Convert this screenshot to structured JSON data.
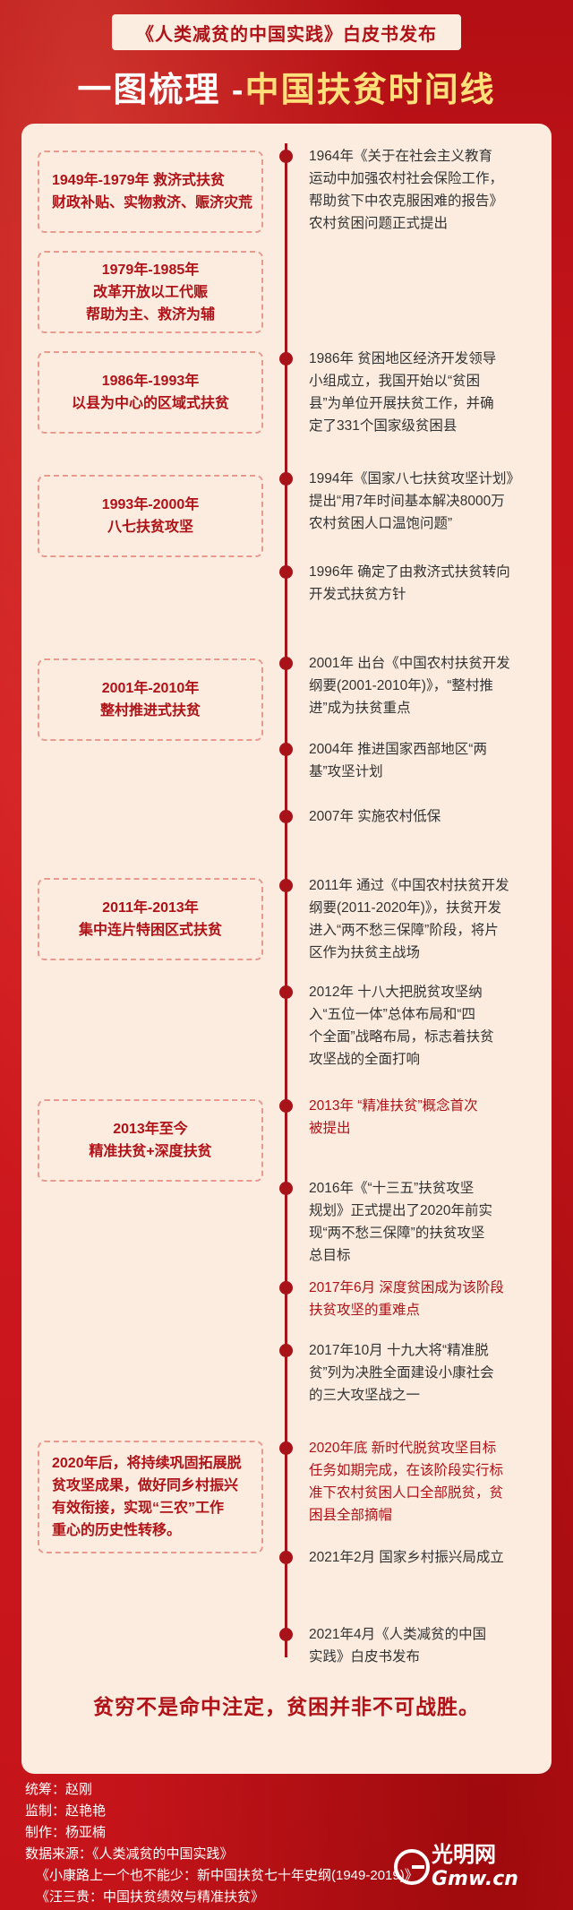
{
  "header": {
    "banner": "《人类减贫的中国实践》白皮书发布",
    "title_part1": "一图梳理 - ",
    "title_part2": "中国扶贫时间线"
  },
  "eras": [
    {
      "lines": [
        "1949年-1979年 救济式扶贫",
        "财政补贴、实物救济、赈济灾荒"
      ]
    },
    {
      "lines": [
        "1979年-1985年",
        "改革开放以工代赈",
        "帮助为主、救济为辅"
      ]
    },
    {
      "lines": [
        "1986年-1993年",
        "以县为中心的区域式扶贫"
      ]
    },
    {
      "lines": [
        "1993年-2000年",
        "八七扶贫攻坚"
      ]
    },
    {
      "lines": [
        "2001年-2010年",
        "整村推进式扶贫"
      ]
    },
    {
      "lines": [
        "2011年-2013年",
        "集中连片特困区式扶贫"
      ]
    },
    {
      "lines": [
        "2013年至今",
        "精准扶贫+深度扶贫"
      ]
    },
    {
      "lines": [
        "2020年后，将持续巩固拓展脱",
        "贫攻坚成果，做好同乡村振兴",
        "有效衔接，实现“三农”工作",
        "重心的历史性转移。"
      ]
    }
  ],
  "events": [
    {
      "lines": [
        "1964年《关于在社会主义教育",
        "运动中加强农村社会保险工作，",
        "帮助贫下中农克服困难的报告》",
        "农村贫困问题正式提出"
      ]
    },
    {
      "lines": [
        "1986年 贫困地区经济开发领导",
        "小组成立，我国开始以“贫困",
        "县”为单位开展扶贫工作，并确",
        "定了331个国家级贫困县"
      ]
    },
    {
      "lines": [
        "1994年《国家八七扶贫攻坚计划》",
        "提出“用7年时间基本解决8000万",
        "农村贫困人口温饱问题”"
      ]
    },
    {
      "lines": [
        "1996年 确定了由救济式扶贫转向",
        "开发式扶贫方针"
      ]
    },
    {
      "lines": [
        "2001年 出台《中国农村扶贫开发",
        "纲要(2001-2010年)》，“整村推",
        "进”成为扶贫重点"
      ]
    },
    {
      "lines": [
        "2004年 推进国家西部地区“两",
        "基”攻坚计划"
      ]
    },
    {
      "lines": [
        "2007年 实施农村低保"
      ]
    },
    {
      "lines": [
        "2011年 通过《中国农村扶贫开发",
        "纲要(2011-2020年)》，扶贫开发",
        "进入“两不愁三保障”阶段，将片",
        "区作为扶贫主战场"
      ]
    },
    {
      "lines": [
        "2012年 十八大把脱贫攻坚纳",
        "入“五位一体”总体布局和“四",
        "个全面”战略布局，标志着扶贫",
        "攻坚战的全面打响"
      ]
    },
    {
      "lines": [
        "2013年 “精准扶贫”概念首次",
        "被提出"
      ]
    },
    {
      "lines": [
        "2016年《“十三五”扶贫攻坚",
        "规划》正式提出了2020年前实",
        "现“两不愁三保障”的扶贫攻坚",
        "总目标"
      ]
    },
    {
      "lines": [
        "2017年6月 深度贫困成为该阶段",
        "扶贫攻坚的重难点"
      ]
    },
    {
      "lines": [
        "2017年10月 十九大将“精准脱",
        "贫”列为决胜全面建设小康社会",
        "的三大攻坚战之一"
      ]
    },
    {
      "lines": [
        "2020年底 新时代脱贫攻坚目标",
        "任务如期完成，在该阶段实行标",
        "准下农村贫困人口全部脱贫，贫",
        "困县全部摘帽"
      ]
    },
    {
      "lines": [
        "2021年2月 国家乡村振兴局成立"
      ]
    },
    {
      "lines": [
        "2021年4月《人类减贫的中国",
        "实践》白皮书发布"
      ]
    }
  ],
  "slogan": "贫穷不是命中注定，贫困并非不可战胜。",
  "credits": {
    "planner": "统筹：赵刚",
    "supervisor": "监制：赵艳艳",
    "producer": "制作：杨亚楠",
    "source_label": "数据来源：《人类减贫的中国实践》",
    "source2": "《小康路上一个也不能少：新中国扶贫七十年史纲(1949-2019)》",
    "source3": "《汪三贵：中国扶贫绩效与精准扶贫》"
  },
  "logo": {
    "text": "光明网",
    "domain": "Gmw.cn"
  },
  "colors": {
    "background": "#c8141a",
    "panel": "#fbecdf",
    "accent": "#b01217",
    "title_highlight": "#ffe07a"
  }
}
